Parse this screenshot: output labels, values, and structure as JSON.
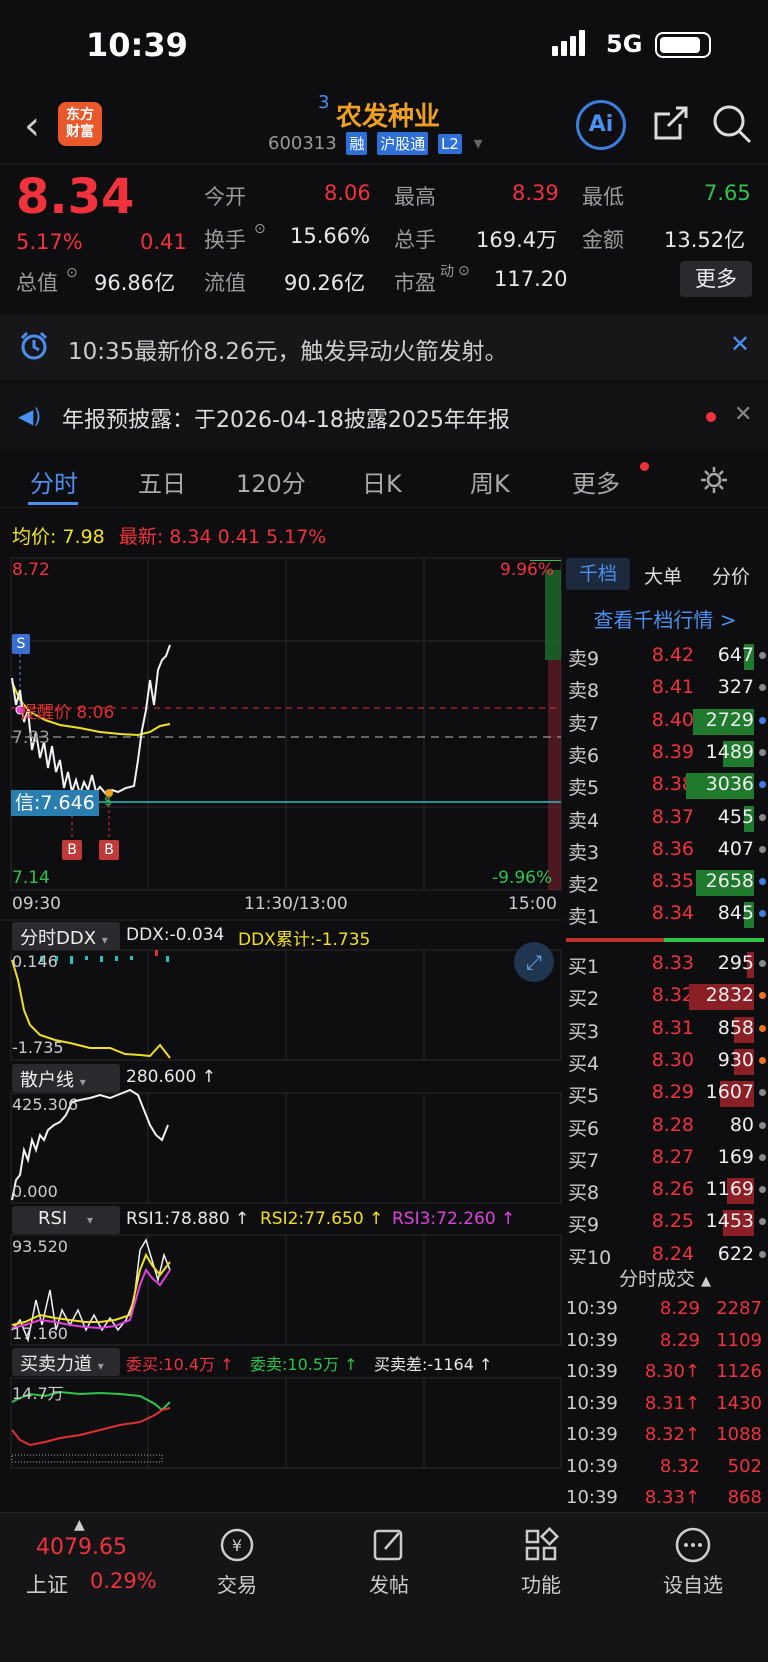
{
  "status": {
    "time": "10:39",
    "network": "5G"
  },
  "nav": {
    "badge_count": "3",
    "stock_name": "农发种业",
    "code": "600313",
    "tags": [
      "融",
      "沪股通",
      "L2"
    ],
    "logo_line1": "东方",
    "logo_line2": "财富",
    "ai_label": "Ai"
  },
  "quote": {
    "price": "8.34",
    "change_pct": "5.17%",
    "change": "0.41",
    "open_label": "今开",
    "open": "8.06",
    "high_label": "最高",
    "high": "8.39",
    "low_label": "最低",
    "low": "7.65",
    "turnover_label": "换手",
    "turnover": "15.66%",
    "volume_label": "总手",
    "volume": "169.4万",
    "amount_label": "金额",
    "amount": "13.52亿",
    "mktcap_label": "总值",
    "mktcap": "96.86亿",
    "float_label": "流值",
    "float_cap": "90.26亿",
    "pe_label": "市盈",
    "pe_sup": "动",
    "pe": "117.20",
    "more_label": "更多"
  },
  "alert": {
    "text": "10:35最新价8.26元，触发异动火箭发射。"
  },
  "notice": {
    "text": "年报预披露：于2026-04-18披露2025年年报"
  },
  "tabs": [
    "分时",
    "五日",
    "120分",
    "日K",
    "周K",
    "更多"
  ],
  "chart": {
    "avg_label": "均价:",
    "avg": "7.98",
    "latest_label": "最新:",
    "latest": "8.34",
    "chg": "0.41",
    "pct": "5.17%",
    "y_top": "8.72",
    "y_bottom": "7.14",
    "pct_top": "9.96%",
    "pct_bottom": "-9.96%",
    "mid_label": "7.93",
    "remind_label": "提醒价 8.06",
    "credit_label": "信:7.646",
    "marker_s": "S",
    "marker_b1": "B",
    "marker_b2": "B",
    "marker_dollar": "$",
    "t_start": "09:30",
    "t_mid": "11:30/13:00",
    "t_end": "15:00"
  },
  "ddx": {
    "select": "分时DDX",
    "ddx_text": "DDX:-0.034",
    "cum_text": "DDX累计:-1.735",
    "y_top": "0.146",
    "y_bottom": "-1.735"
  },
  "retail": {
    "select": "散户线",
    "value": "280.600 ↑",
    "y_top": "425.306",
    "y_bottom": "0.000"
  },
  "rsi": {
    "select": "RSI",
    "rsi1": "RSI1:78.880 ↑",
    "rsi2": "RSI2:77.650 ↑",
    "rsi3": "RSI3:72.260 ↑",
    "y_top": "93.520",
    "y_bottom": "17.160"
  },
  "force": {
    "select": "买卖力道",
    "buy": "委买:10.4万 ↑",
    "sell": "委卖:10.5万 ↑",
    "diff": "买卖差:-1164 ↑",
    "y_top": "14.7万"
  },
  "side": {
    "tabs": [
      "千档",
      "大单",
      "分价"
    ],
    "link": "查看千档行情 >",
    "asks": [
      {
        "label": "卖9",
        "price": "8.42",
        "vol": "647",
        "fill": 0.15,
        "dot": "#888"
      },
      {
        "label": "卖8",
        "price": "8.41",
        "vol": "327",
        "fill": 0.0,
        "dot": "#888"
      },
      {
        "label": "卖7",
        "price": "8.40",
        "vol": "2729",
        "fill": 0.9,
        "dot": "#3d7fe0"
      },
      {
        "label": "卖6",
        "price": "8.39",
        "vol": "1489",
        "fill": 0.45,
        "dot": "#888"
      },
      {
        "label": "卖5",
        "price": "8.38",
        "vol": "3036",
        "fill": 1.0,
        "dot": "#3d7fe0"
      },
      {
        "label": "卖4",
        "price": "8.37",
        "vol": "455",
        "fill": 0.15,
        "dot": "#888"
      },
      {
        "label": "卖3",
        "price": "8.36",
        "vol": "407",
        "fill": 0.0,
        "dot": "#888"
      },
      {
        "label": "卖2",
        "price": "8.35",
        "vol": "2658",
        "fill": 0.85,
        "dot": "#3d7fe0"
      },
      {
        "label": "卖1",
        "price": "8.34",
        "vol": "845",
        "fill": 0.15,
        "dot": "#3d7fe0"
      }
    ],
    "bids": [
      {
        "label": "买1",
        "price": "8.33",
        "vol": "295",
        "fill": 0.1,
        "dot": "#888"
      },
      {
        "label": "买2",
        "price": "8.32",
        "vol": "2832",
        "fill": 0.95,
        "dot": "#f07020"
      },
      {
        "label": "买3",
        "price": "8.31",
        "vol": "858",
        "fill": 0.3,
        "dot": "#f07020"
      },
      {
        "label": "买4",
        "price": "8.30",
        "vol": "930",
        "fill": 0.3,
        "dot": "#f07020"
      },
      {
        "label": "买5",
        "price": "8.29",
        "vol": "1607",
        "fill": 0.5,
        "dot": "#888"
      },
      {
        "label": "买6",
        "price": "8.28",
        "vol": "80",
        "fill": 0.0,
        "dot": "#888"
      },
      {
        "label": "买7",
        "price": "8.27",
        "vol": "169",
        "fill": 0.0,
        "dot": "#888"
      },
      {
        "label": "买8",
        "price": "8.26",
        "vol": "1169",
        "fill": 0.4,
        "dot": "#888"
      },
      {
        "label": "买9",
        "price": "8.25",
        "vol": "1453",
        "fill": 0.45,
        "dot": "#888"
      },
      {
        "label": "买10",
        "price": "8.24",
        "vol": "622",
        "fill": 0.0,
        "dot": "#888"
      }
    ],
    "trades_title": "分时成交",
    "trades": [
      {
        "t": "10:39",
        "p": "8.29",
        "v": "2287"
      },
      {
        "t": "10:39",
        "p": "8.29",
        "v": "1109"
      },
      {
        "t": "10:39",
        "p": "8.30↑",
        "v": "1126"
      },
      {
        "t": "10:39",
        "p": "8.31↑",
        "v": "1430"
      },
      {
        "t": "10:39",
        "p": "8.32↑",
        "v": "1088"
      },
      {
        "t": "10:39",
        "p": "8.32",
        "v": "502"
      },
      {
        "t": "10:39",
        "p": "8.33↑",
        "v": "868"
      }
    ]
  },
  "bottom": {
    "index_value": "4079.65",
    "index_name": "上证",
    "index_pct": "0.29%",
    "items": [
      "交易",
      "发帖",
      "功能",
      "设自选"
    ]
  }
}
